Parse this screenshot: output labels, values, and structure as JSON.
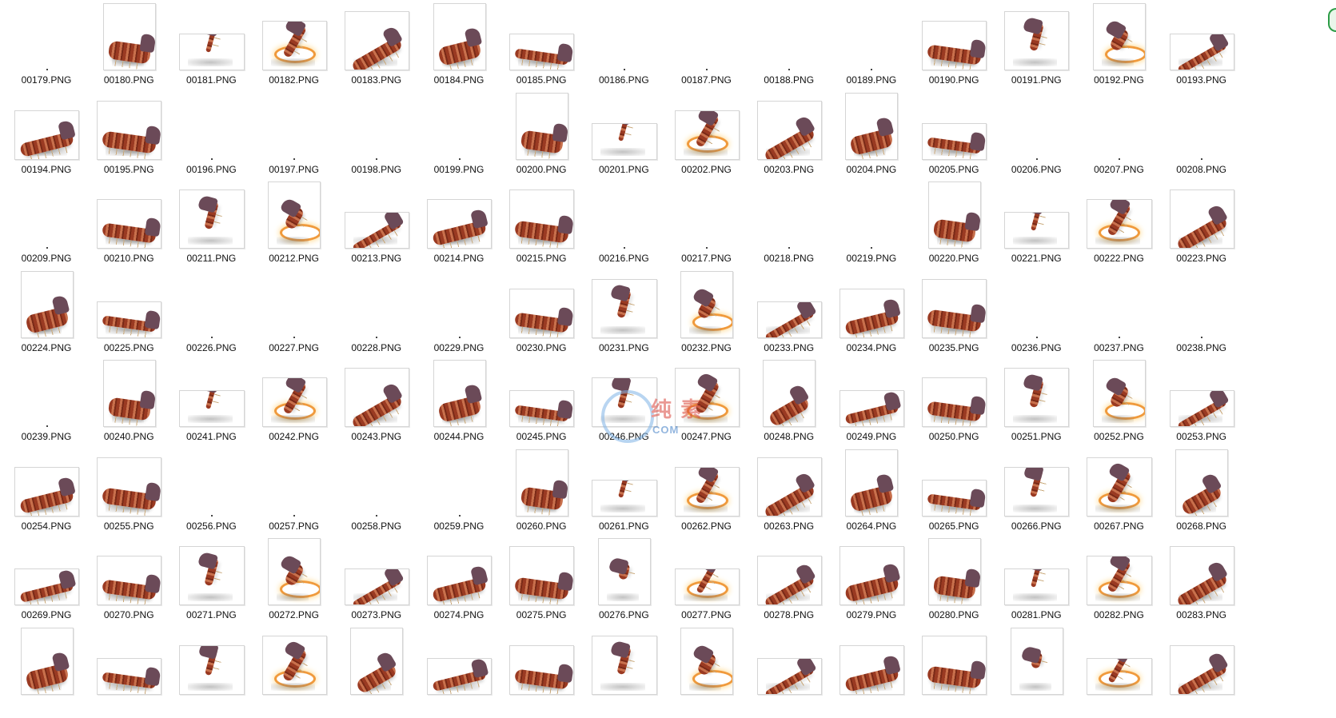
{
  "window": {
    "view_mode": "large-icons",
    "edge_icon": "circle-badge-icon"
  },
  "watermark": {
    "glyphs": "纯 素",
    "site": "COM"
  },
  "files": [
    {
      "name": "00179.PNG",
      "thumb": "empty"
    },
    {
      "name": "00180.PNG",
      "thumb": "image"
    },
    {
      "name": "00181.PNG",
      "thumb": "image"
    },
    {
      "name": "00182.PNG",
      "thumb": "image"
    },
    {
      "name": "00183.PNG",
      "thumb": "image"
    },
    {
      "name": "00184.PNG",
      "thumb": "image"
    },
    {
      "name": "00185.PNG",
      "thumb": "image"
    },
    {
      "name": "00186.PNG",
      "thumb": "empty"
    },
    {
      "name": "00187.PNG",
      "thumb": "empty"
    },
    {
      "name": "00188.PNG",
      "thumb": "empty"
    },
    {
      "name": "00189.PNG",
      "thumb": "empty"
    },
    {
      "name": "00190.PNG",
      "thumb": "image"
    },
    {
      "name": "00191.PNG",
      "thumb": "image"
    },
    {
      "name": "00192.PNG",
      "thumb": "image"
    },
    {
      "name": "00193.PNG",
      "thumb": "image"
    },
    {
      "name": "00194.PNG",
      "thumb": "image"
    },
    {
      "name": "00195.PNG",
      "thumb": "image"
    },
    {
      "name": "00196.PNG",
      "thumb": "empty"
    },
    {
      "name": "00197.PNG",
      "thumb": "empty"
    },
    {
      "name": "00198.PNG",
      "thumb": "empty"
    },
    {
      "name": "00199.PNG",
      "thumb": "empty"
    },
    {
      "name": "00200.PNG",
      "thumb": "image"
    },
    {
      "name": "00201.PNG",
      "thumb": "image"
    },
    {
      "name": "00202.PNG",
      "thumb": "image"
    },
    {
      "name": "00203.PNG",
      "thumb": "image"
    },
    {
      "name": "00204.PNG",
      "thumb": "image"
    },
    {
      "name": "00205.PNG",
      "thumb": "image"
    },
    {
      "name": "00206.PNG",
      "thumb": "empty"
    },
    {
      "name": "00207.PNG",
      "thumb": "empty"
    },
    {
      "name": "00208.PNG",
      "thumb": "empty"
    },
    {
      "name": "00209.PNG",
      "thumb": "empty"
    },
    {
      "name": "00210.PNG",
      "thumb": "image"
    },
    {
      "name": "00211.PNG",
      "thumb": "image"
    },
    {
      "name": "00212.PNG",
      "thumb": "image"
    },
    {
      "name": "00213.PNG",
      "thumb": "image"
    },
    {
      "name": "00214.PNG",
      "thumb": "image"
    },
    {
      "name": "00215.PNG",
      "thumb": "image"
    },
    {
      "name": "00216.PNG",
      "thumb": "empty"
    },
    {
      "name": "00217.PNG",
      "thumb": "empty"
    },
    {
      "name": "00218.PNG",
      "thumb": "empty"
    },
    {
      "name": "00219.PNG",
      "thumb": "empty"
    },
    {
      "name": "00220.PNG",
      "thumb": "image"
    },
    {
      "name": "00221.PNG",
      "thumb": "image"
    },
    {
      "name": "00222.PNG",
      "thumb": "image"
    },
    {
      "name": "00223.PNG",
      "thumb": "image"
    },
    {
      "name": "00224.PNG",
      "thumb": "image"
    },
    {
      "name": "00225.PNG",
      "thumb": "image"
    },
    {
      "name": "00226.PNG",
      "thumb": "empty"
    },
    {
      "name": "00227.PNG",
      "thumb": "empty"
    },
    {
      "name": "00228.PNG",
      "thumb": "empty"
    },
    {
      "name": "00229.PNG",
      "thumb": "empty"
    },
    {
      "name": "00230.PNG",
      "thumb": "image"
    },
    {
      "name": "00231.PNG",
      "thumb": "image"
    },
    {
      "name": "00232.PNG",
      "thumb": "image"
    },
    {
      "name": "00233.PNG",
      "thumb": "image"
    },
    {
      "name": "00234.PNG",
      "thumb": "image"
    },
    {
      "name": "00235.PNG",
      "thumb": "image"
    },
    {
      "name": "00236.PNG",
      "thumb": "empty"
    },
    {
      "name": "00237.PNG",
      "thumb": "empty"
    },
    {
      "name": "00238.PNG",
      "thumb": "empty"
    },
    {
      "name": "00239.PNG",
      "thumb": "empty"
    },
    {
      "name": "00240.PNG",
      "thumb": "image"
    },
    {
      "name": "00241.PNG",
      "thumb": "image"
    },
    {
      "name": "00242.PNG",
      "thumb": "image"
    },
    {
      "name": "00243.PNG",
      "thumb": "image"
    },
    {
      "name": "00244.PNG",
      "thumb": "image"
    },
    {
      "name": "00245.PNG",
      "thumb": "image"
    },
    {
      "name": "00246.PNG",
      "thumb": "image"
    },
    {
      "name": "00247.PNG",
      "thumb": "image"
    },
    {
      "name": "00248.PNG",
      "thumb": "image"
    },
    {
      "name": "00249.PNG",
      "thumb": "image"
    },
    {
      "name": "00250.PNG",
      "thumb": "image"
    },
    {
      "name": "00251.PNG",
      "thumb": "image"
    },
    {
      "name": "00252.PNG",
      "thumb": "image"
    },
    {
      "name": "00253.PNG",
      "thumb": "image"
    },
    {
      "name": "00254.PNG",
      "thumb": "image"
    },
    {
      "name": "00255.PNG",
      "thumb": "image"
    },
    {
      "name": "00256.PNG",
      "thumb": "empty"
    },
    {
      "name": "00257.PNG",
      "thumb": "empty"
    },
    {
      "name": "00258.PNG",
      "thumb": "empty"
    },
    {
      "name": "00259.PNG",
      "thumb": "empty"
    },
    {
      "name": "00260.PNG",
      "thumb": "image"
    },
    {
      "name": "00261.PNG",
      "thumb": "image"
    },
    {
      "name": "00262.PNG",
      "thumb": "image"
    },
    {
      "name": "00263.PNG",
      "thumb": "image"
    },
    {
      "name": "00264.PNG",
      "thumb": "image"
    },
    {
      "name": "00265.PNG",
      "thumb": "image"
    },
    {
      "name": "00266.PNG",
      "thumb": "image"
    },
    {
      "name": "00267.PNG",
      "thumb": "image"
    },
    {
      "name": "00268.PNG",
      "thumb": "image"
    },
    {
      "name": "00269.PNG",
      "thumb": "image"
    },
    {
      "name": "00270.PNG",
      "thumb": "image"
    },
    {
      "name": "00271.PNG",
      "thumb": "image"
    },
    {
      "name": "00272.PNG",
      "thumb": "image"
    },
    {
      "name": "00273.PNG",
      "thumb": "image"
    },
    {
      "name": "00274.PNG",
      "thumb": "image"
    },
    {
      "name": "00275.PNG",
      "thumb": "image"
    },
    {
      "name": "00276.PNG",
      "thumb": "image"
    },
    {
      "name": "00277.PNG",
      "thumb": "image"
    },
    {
      "name": "00278.PNG",
      "thumb": "image"
    },
    {
      "name": "00279.PNG",
      "thumb": "image"
    },
    {
      "name": "00280.PNG",
      "thumb": "image"
    },
    {
      "name": "00281.PNG",
      "thumb": "image"
    },
    {
      "name": "00282.PNG",
      "thumb": "image"
    },
    {
      "name": "00283.PNG",
      "thumb": "image"
    },
    {
      "name": "",
      "thumb": "image"
    },
    {
      "name": "",
      "thumb": "image"
    },
    {
      "name": "",
      "thumb": "image"
    },
    {
      "name": "",
      "thumb": "image"
    },
    {
      "name": "",
      "thumb": "image"
    },
    {
      "name": "",
      "thumb": "image"
    },
    {
      "name": "",
      "thumb": "image"
    },
    {
      "name": "",
      "thumb": "image"
    },
    {
      "name": "",
      "thumb": "image"
    },
    {
      "name": "",
      "thumb": "image"
    },
    {
      "name": "",
      "thumb": "image"
    },
    {
      "name": "",
      "thumb": "image"
    },
    {
      "name": "",
      "thumb": "image"
    },
    {
      "name": "",
      "thumb": "image"
    },
    {
      "name": "",
      "thumb": "image"
    }
  ]
}
